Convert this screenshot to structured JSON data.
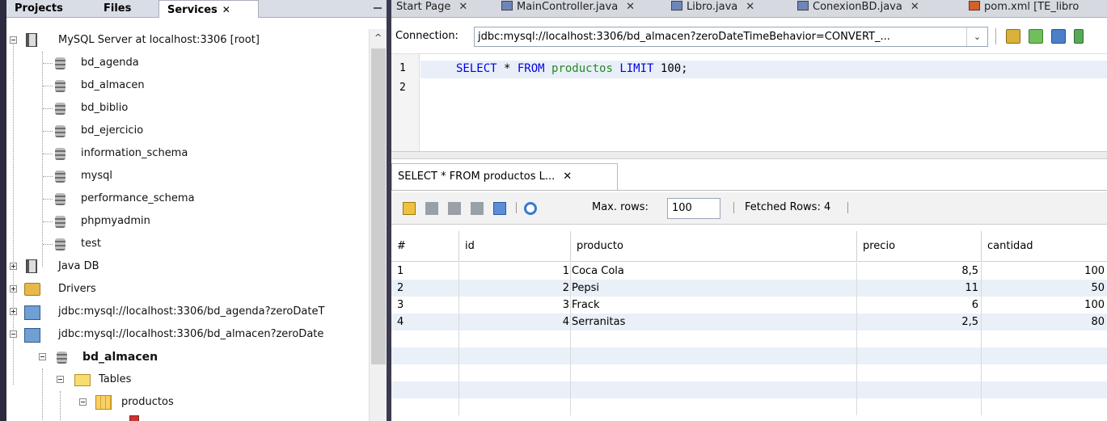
{
  "left_panel": {
    "tabs": [
      "Projects",
      "Files",
      "Services"
    ],
    "services_close": "✕",
    "tree": {
      "mysql_server": "MySQL Server at localhost:3306 [root]",
      "databases": [
        "bd_agenda",
        "bd_almacen",
        "bd_biblio",
        "bd_ejercicio",
        "information_schema",
        "mysql",
        "performance_schema",
        "phpmyadmin",
        "test"
      ],
      "java_db": "Java DB",
      "drivers": "Drivers",
      "conn_agenda": "jdbc:mysql://localhost:3306/bd_agenda?zeroDateT",
      "conn_almacen": "jdbc:mysql://localhost:3306/bd_almacen?zeroDate",
      "schema": "bd_almacen",
      "tables": "Tables",
      "table": "productos"
    }
  },
  "editor_tabs": [
    {
      "label": "Start Page",
      "icon": "none"
    },
    {
      "label": "MainController.java",
      "icon": "java-file-icon"
    },
    {
      "label": "Libro.java",
      "icon": "java-file-icon"
    },
    {
      "label": "ConexionBD.java",
      "icon": "java-file-icon"
    },
    {
      "label": "pom.xml [TE_libro",
      "icon": "maven-file-icon"
    }
  ],
  "connection": {
    "label": "Connection:",
    "value": "jdbc:mysql://localhost:3306/bd_almacen?zeroDateTimeBehavior=CONVERT_..."
  },
  "editor": {
    "line_numbers": [
      "1",
      "2"
    ],
    "sql": {
      "kw1": "SELECT",
      "star": " * ",
      "kw2": "FROM",
      "table": " productos ",
      "kw3": "LIMIT",
      "num": " 100;"
    }
  },
  "result": {
    "tab_label": "SELECT * FROM productos L...",
    "tab_close": "✕",
    "max_rows_label": "Max. rows:",
    "max_rows_value": "100",
    "fetched_label": "Fetched Rows: 4",
    "columns": [
      "#",
      "id",
      "producto",
      "precio",
      "cantidad"
    ],
    "rows": [
      [
        "1",
        "1",
        "Coca Cola",
        "8,5",
        "100"
      ],
      [
        "2",
        "2",
        "Pepsi",
        "11",
        "50"
      ],
      [
        "3",
        "3",
        "Frack",
        "6",
        "100"
      ],
      [
        "4",
        "4",
        "Serranitas",
        "2,5",
        "80"
      ]
    ]
  },
  "colors": {
    "accent_tab": "#d6d9e0",
    "row_alt": "#eaf0f8",
    "keyword": "#0000e6",
    "table_name": "#228b22"
  }
}
